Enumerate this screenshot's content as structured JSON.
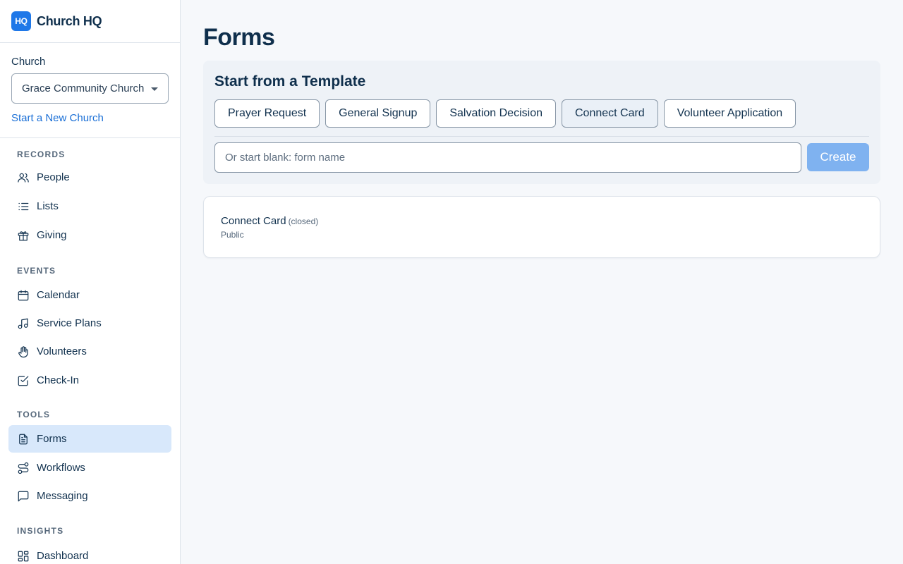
{
  "brand": {
    "logo_text": "HQ",
    "name": "Church HQ",
    "accent": "#1f78e8"
  },
  "church_picker": {
    "label": "Church",
    "selected": "Grace Community Church",
    "new_link": "Start a New Church"
  },
  "nav": {
    "sections": [
      {
        "title": "RECORDS",
        "items": [
          {
            "label": "People",
            "icon": "people-icon"
          },
          {
            "label": "Lists",
            "icon": "list-icon"
          },
          {
            "label": "Giving",
            "icon": "gift-icon"
          }
        ]
      },
      {
        "title": "EVENTS",
        "items": [
          {
            "label": "Calendar",
            "icon": "calendar-icon"
          },
          {
            "label": "Service Plans",
            "icon": "music-note-icon"
          },
          {
            "label": "Volunteers",
            "icon": "hand-icon"
          },
          {
            "label": "Check-In",
            "icon": "check-square-icon"
          }
        ]
      },
      {
        "title": "TOOLS",
        "items": [
          {
            "label": "Forms",
            "icon": "document-icon",
            "active": true
          },
          {
            "label": "Workflows",
            "icon": "route-icon"
          },
          {
            "label": "Messaging",
            "icon": "chat-bubble-icon"
          }
        ]
      },
      {
        "title": "INSIGHTS",
        "items": [
          {
            "label": "Dashboard",
            "icon": "dashboard-icon"
          }
        ]
      }
    ],
    "active_color": "#d8e8fb"
  },
  "page": {
    "title": "Forms"
  },
  "templates": {
    "heading": "Start from a Template",
    "buttons": [
      "Prayer Request",
      "General Signup",
      "Salvation Decision",
      "Connect Card",
      "Volunteer Application"
    ],
    "selected": "Connect Card",
    "input_placeholder": "Or start blank: form name",
    "input_value": "",
    "create_label": "Create"
  },
  "forms": [
    {
      "name": "Connect Card",
      "status": "(closed)",
      "visibility": "Public"
    }
  ]
}
